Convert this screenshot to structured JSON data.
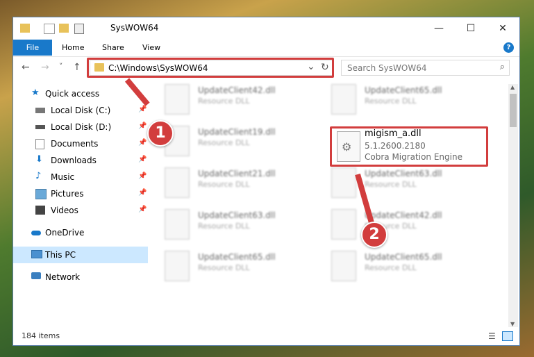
{
  "window": {
    "title": "SysWOW64"
  },
  "ribbon": {
    "tabs": [
      "File",
      "Home",
      "Share",
      "View"
    ],
    "help": "?"
  },
  "nav": {
    "back": "←",
    "forward": "→",
    "recent": "˅",
    "up": "↑",
    "address": "C:\\Windows\\SysWOW64",
    "dropdown": "⌄",
    "refresh": "↻",
    "search_placeholder": "Search SysWOW64"
  },
  "sidebar": {
    "items": [
      {
        "label": "Quick access"
      },
      {
        "label": "Local Disk (C:)"
      },
      {
        "label": "Local Disk (D:)"
      },
      {
        "label": "Documents"
      },
      {
        "label": "Downloads"
      },
      {
        "label": "Music"
      },
      {
        "label": "Pictures"
      },
      {
        "label": "Videos"
      },
      {
        "label": "OneDrive"
      },
      {
        "label": "This PC"
      },
      {
        "label": "Network"
      }
    ]
  },
  "files": [
    {
      "name": "UpdateClient42.dll",
      "type": "Resource DLL"
    },
    {
      "name": "UpdateClient65.dll",
      "type": "Resource DLL"
    },
    {
      "name": "UpdateClient19.dll",
      "type": "Resource DLL"
    },
    {
      "name": "UpdateClient21.dll",
      "type": "Resource DLL"
    },
    {
      "name": "UpdateClient63.dll",
      "type": "Resource DLL"
    },
    {
      "name": "UpdateClient63.dll",
      "type": "Resource DLL"
    },
    {
      "name": "UpdateClient42.dll",
      "type": "Resource DLL"
    },
    {
      "name": "UpdateClient65.dll",
      "type": "Resource DLL"
    },
    {
      "name": "UpdateClient65.dll",
      "type": "Resource DLL"
    }
  ],
  "highlighted_file": {
    "name": "migism_a.dll",
    "version": "5.1.2600.2180",
    "description": "Cobra Migration Engine"
  },
  "status": {
    "count": "184 items"
  },
  "callouts": {
    "one": "1",
    "two": "2"
  },
  "colors": {
    "accent": "#1979ca",
    "callout": "#d23d3d"
  }
}
